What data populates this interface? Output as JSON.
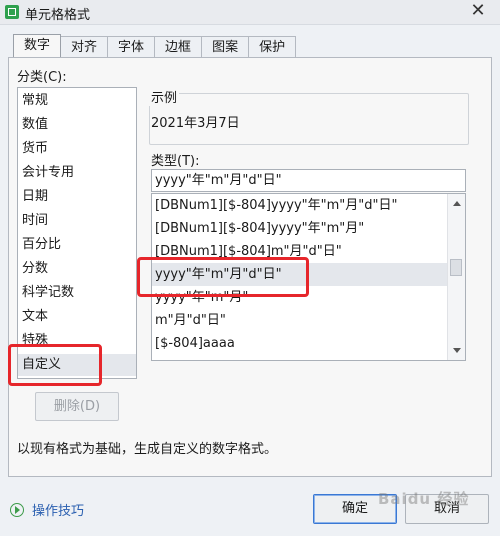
{
  "window": {
    "title": "单元格格式",
    "close_glyph": "✕"
  },
  "tabs": [
    {
      "label": "数字",
      "active": true
    },
    {
      "label": "对齐"
    },
    {
      "label": "字体"
    },
    {
      "label": "边框"
    },
    {
      "label": "图案"
    },
    {
      "label": "保护"
    }
  ],
  "category": {
    "label": "分类(C):",
    "items": [
      "常规",
      "数值",
      "货币",
      "会计专用",
      "日期",
      "时间",
      "百分比",
      "分数",
      "科学记数",
      "文本",
      "特殊",
      "自定义"
    ],
    "selected": "自定义"
  },
  "delete_button": "删除(D)",
  "sample": {
    "label": "示例",
    "value": "2021年3月7日"
  },
  "type": {
    "label": "类型(T):",
    "value": "yyyy\"年\"m\"月\"d\"日\"",
    "items": [
      "[DBNum1][$-804]yyyy\"年\"m\"月\"d\"日\"",
      "[DBNum1][$-804]yyyy\"年\"m\"月\"",
      "[DBNum1][$-804]m\"月\"d\"日\"",
      "yyyy\"年\"m\"月\"d\"日\"",
      "yyyy\"年\"m\"月\"",
      "m\"月\"d\"日\"",
      "[$-804]aaaa"
    ],
    "selected_index": 3
  },
  "description": "以现有格式为基础，生成自定义的数字格式。",
  "tips_link": "操作技巧",
  "ok_button": "确定",
  "cancel_button": "取消",
  "watermark": "Baidu 经验",
  "colors": {
    "highlight_box": "#e6262b",
    "link": "#2a5fb0",
    "focus": "#3a78d4"
  },
  "icons": {
    "app": "spreadsheet-icon",
    "close": "close-icon",
    "tips": "play-circle-icon"
  }
}
